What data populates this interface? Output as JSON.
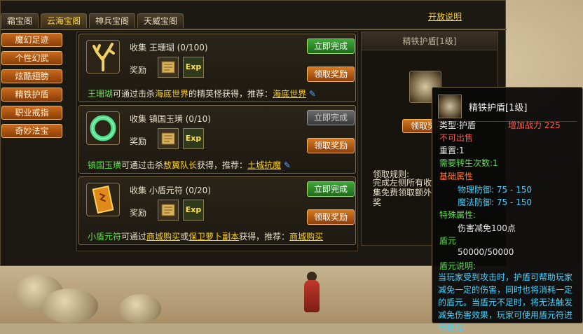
{
  "window": {
    "tabs": [
      "霜宝阁",
      "云海宝阁",
      "神兵宝阁",
      "天威宝阁"
    ],
    "active_tab": 1,
    "open_link": "开放说明"
  },
  "menu": [
    "魔幻足迹",
    "个性幻武",
    "炫酷翅膀",
    "精铁护盾",
    "职业戒指",
    "奇妙法宝"
  ],
  "quests": [
    {
      "title": "收集  王珊瑚 (0/100)",
      "reward_label": "奖励",
      "done_label": "立即完成",
      "done_enabled": true,
      "claim_label": "领取奖励",
      "exp": "Exp",
      "desc_item": "王珊瑚",
      "desc_pre": "可通过击杀",
      "desc_place": "海底世界",
      "desc_post": "的精英怪获得，推荐：",
      "desc_link": "海底世界"
    },
    {
      "title": "收集  镇国玉璜 (0/10)",
      "reward_label": "奖励",
      "done_label": "立即完成",
      "done_enabled": false,
      "claim_label": "领取奖励",
      "exp": "Exp",
      "desc_item": "镇国玉璜",
      "desc_pre": "可通过击杀",
      "desc_place": "敖翼队长",
      "desc_post": "获得，推荐：",
      "desc_link": "土城抗魔"
    },
    {
      "title": "收集  小盾元符 (0/20)",
      "reward_label": "奖励",
      "done_label": "立即完成",
      "done_enabled": true,
      "claim_label": "领取奖励",
      "exp": "Exp",
      "desc_item": "小盾元符",
      "desc_pre": "可通过",
      "desc_place": "商城购买",
      "desc_mid": "或",
      "desc_place2": "保卫萝卜副本",
      "desc_post": "获得，推荐：",
      "desc_link": "商城购买"
    }
  ],
  "detail": {
    "header": "精铁护盾[1级]",
    "button": "领取奖",
    "rule_label": "领取规则:",
    "rule_text": "完成左侧所有收集免费领取额外奖"
  },
  "tooltip": {
    "name": "精铁护盾[1级]",
    "type": "类型:护盾",
    "power_label": "增加战力",
    "power_value": "225",
    "not_sellable": "不可出售",
    "weight": "重置:1",
    "reincarnate": "需要转生次数:1",
    "base_title": "基础属性",
    "phys_def": "物理防御:  75 - 150",
    "mag_def": "魔法防御:  75 - 150",
    "special_title": "特殊属性:",
    "special_value": "伤害减免100点",
    "shield_title": "盾元",
    "shield_value": "50000/50000",
    "desc_title": "盾元说明:",
    "desc_text": "当玩家受到攻击时，护盾可帮助玩家减免一定的伤害，同时也将消耗一定的盾元。当盾元不足时，将无法触发减免伤害效果，玩家可使用盾元符进行补充!"
  }
}
